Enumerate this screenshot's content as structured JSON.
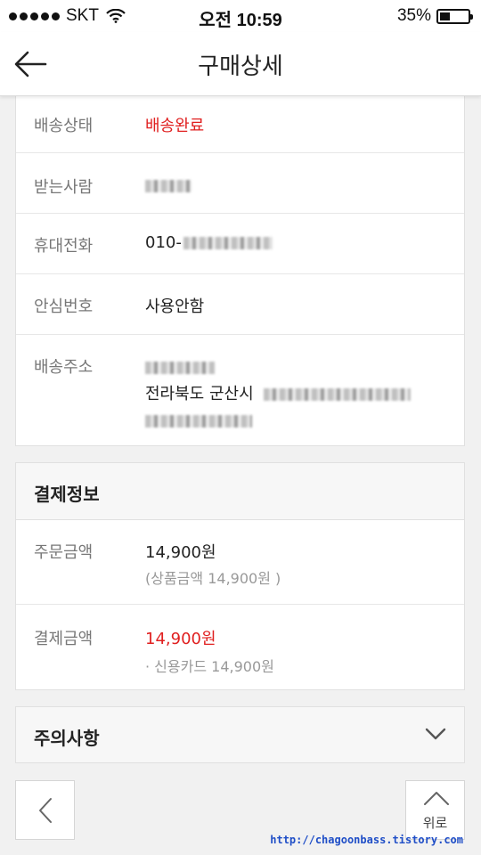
{
  "status_bar": {
    "carrier": "SKT",
    "time": "오전 10:59",
    "battery": "35%",
    "battery_level": 0.35
  },
  "header": {
    "title": "구매상세"
  },
  "delivery": {
    "rows": [
      {
        "label": "배송상태",
        "value": "배송완료"
      },
      {
        "label": "받는사람",
        "value": ""
      },
      {
        "label": "휴대전화",
        "value": "010-"
      },
      {
        "label": "안심번호",
        "value": "사용안함"
      },
      {
        "label": "배송주소",
        "value": "전라북도 군산시"
      }
    ]
  },
  "payment": {
    "title": "결제정보",
    "order_label": "주문금액",
    "order_amount": "14,900원",
    "order_detail": "(상품금액 14,900원 )",
    "paid_label": "결제금액",
    "paid_amount": "14,900원",
    "paid_detail": "· 신용카드 14,900원"
  },
  "notice": {
    "title": "주의사항"
  },
  "nav": {
    "top_label": "위로"
  },
  "watermark": "http://chagoonbass.tistory.com",
  "colors": {
    "accent_red": "#e02020"
  }
}
